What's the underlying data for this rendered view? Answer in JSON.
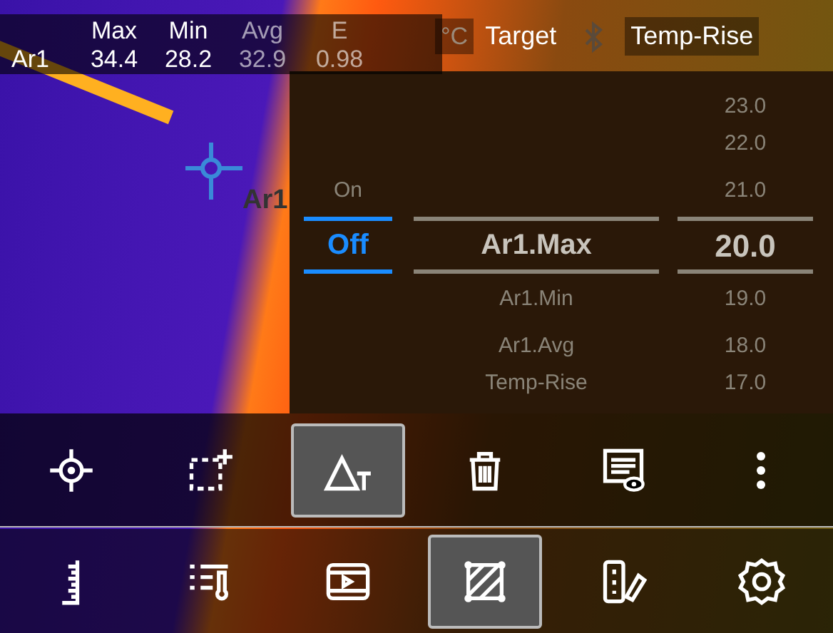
{
  "measurement_table": {
    "columns": [
      "Max",
      "Min",
      "Avg",
      "E"
    ],
    "rows": [
      {
        "label": "Ar1",
        "values": [
          "34.4",
          "28.2",
          "32.9",
          "0.98"
        ]
      }
    ]
  },
  "unit": "°C",
  "header_labels": [
    "Target",
    "Temp-Rise"
  ],
  "cursor_label": "Ar1",
  "picker": {
    "switch": [
      {
        "label": "On",
        "selected": false
      },
      {
        "label": "Off",
        "selected": true
      }
    ],
    "targets": [
      {
        "label": "Ar1.Max",
        "selected": true
      },
      {
        "label": "Ar1.Min",
        "selected": false
      },
      {
        "label": "Ar1.Avg",
        "selected": false
      },
      {
        "label": "Temp-Rise",
        "selected": false
      }
    ],
    "values": [
      {
        "label": "23.0",
        "selected": false
      },
      {
        "label": "22.0",
        "selected": false
      },
      {
        "label": "21.0",
        "selected": false
      },
      {
        "label": "20.0",
        "selected": true
      },
      {
        "label": "19.0",
        "selected": false
      },
      {
        "label": "18.0",
        "selected": false
      },
      {
        "label": "17.0",
        "selected": false
      }
    ]
  },
  "toolbar_top": [
    {
      "kind": "spot",
      "selected": false
    },
    {
      "kind": "add-area",
      "selected": false
    },
    {
      "kind": "delta-t",
      "selected": true
    },
    {
      "kind": "delete",
      "selected": false
    },
    {
      "kind": "view-list",
      "selected": false
    },
    {
      "kind": "more",
      "selected": false
    }
  ],
  "toolbar_bottom": [
    {
      "kind": "ruler",
      "selected": false
    },
    {
      "kind": "temp-settings",
      "selected": false
    },
    {
      "kind": "video",
      "selected": false
    },
    {
      "kind": "area",
      "selected": true
    },
    {
      "kind": "palette",
      "selected": false
    },
    {
      "kind": "settings",
      "selected": false
    }
  ]
}
